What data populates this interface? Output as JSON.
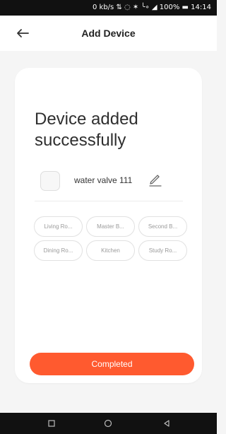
{
  "status_bar": {
    "text": "0 kb/s ⇅ ◌ ✶ ╰∘ ◢ 100% ▬ 14:14"
  },
  "header": {
    "title": "Add Device",
    "back_icon": "arrow-left-icon"
  },
  "card": {
    "title_line1": "Device added",
    "title_line2": "successfully",
    "device": {
      "name": "water valve 111",
      "edit_icon": "pencil-icon"
    },
    "rooms": [
      "Living Ro...",
      "Master B...",
      "Second B...",
      "Dining Ro...",
      "Kitchen",
      "Study Ro..."
    ],
    "complete_label": "Completed"
  },
  "colors": {
    "accent": "#ff5a2f",
    "background": "#f5f5f5",
    "card": "#ffffff",
    "status_bar": "#111111"
  },
  "bottom_nav": {
    "icons": [
      "square-icon",
      "circle-icon",
      "triangle-back-icon"
    ]
  }
}
